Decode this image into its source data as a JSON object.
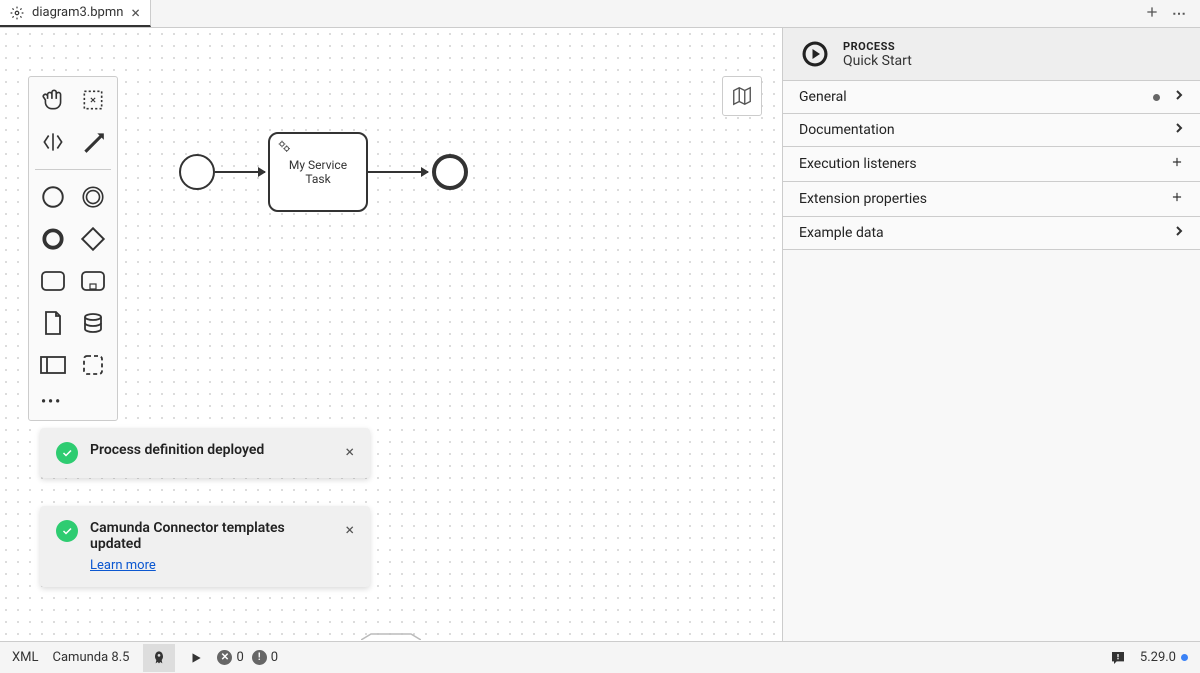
{
  "tab": {
    "title": "diagram3.bpmn"
  },
  "diagram": {
    "task_label": "My Service Task"
  },
  "toasts": [
    {
      "title": "Process definition deployed",
      "link": null
    },
    {
      "title": "Camunda Connector templates updated",
      "link": "Learn more"
    }
  ],
  "panel": {
    "type_label": "PROCESS",
    "subtitle": "Quick Start",
    "sections": [
      {
        "title": "General",
        "indicator": "dot",
        "action": "chevron"
      },
      {
        "title": "Documentation",
        "indicator": null,
        "action": "chevron"
      },
      {
        "title": "Execution listeners",
        "indicator": null,
        "action": "plus"
      },
      {
        "title": "Extension properties",
        "indicator": null,
        "action": "plus"
      },
      {
        "title": "Example data",
        "indicator": null,
        "action": "chevron"
      }
    ]
  },
  "status": {
    "xml": "XML",
    "engine": "Camunda 8.5",
    "error_count": "0",
    "warning_count": "0",
    "version": "5.29.0"
  }
}
